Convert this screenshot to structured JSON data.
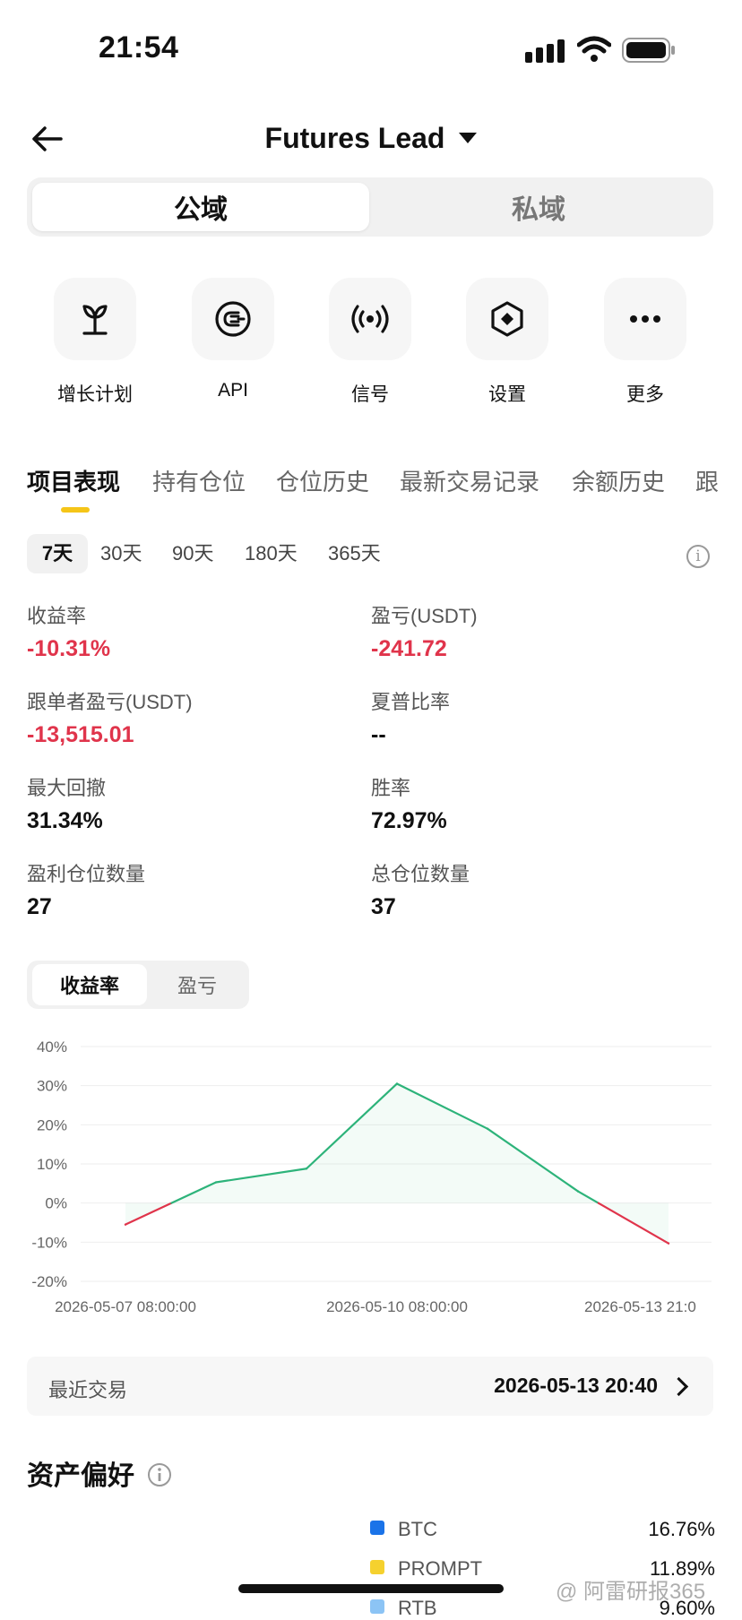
{
  "status_bar": {
    "time": "21:54"
  },
  "header": {
    "title": "Futures Lead"
  },
  "segment": {
    "active": "公域",
    "inactive": "私域"
  },
  "actions": [
    {
      "label": "增长计划",
      "icon": "sprout-icon"
    },
    {
      "label": "API",
      "icon": "plug-icon"
    },
    {
      "label": "信号",
      "icon": "signal-broadcast-icon"
    },
    {
      "label": "设置",
      "icon": "hexagon-settings-icon"
    },
    {
      "label": "更多",
      "icon": "more-dots-icon"
    }
  ],
  "tabs": [
    "项目表现",
    "持有仓位",
    "仓位历史",
    "最新交易记录",
    "余额历史",
    "跟"
  ],
  "periods": [
    "7天",
    "30天",
    "90天",
    "180天",
    "365天"
  ],
  "metrics": [
    {
      "label": "收益率",
      "value": "-10.31%"
    },
    {
      "label": "盈亏(USDT)",
      "value": "-241.72"
    },
    {
      "label": "跟单者盈亏(USDT)",
      "value": "-13,515.01"
    },
    {
      "label": "夏普比率",
      "value": "--"
    },
    {
      "label": "最大回撤",
      "value": "31.34%"
    },
    {
      "label": "胜率",
      "value": "72.97%"
    },
    {
      "label": "盈利仓位数量",
      "value": "27"
    },
    {
      "label": "总仓位数量",
      "value": "37"
    }
  ],
  "chart_toggle": {
    "active": "收益率",
    "inactive": "盈亏"
  },
  "chart_data": {
    "type": "line",
    "title": "",
    "xlabel": "",
    "ylabel": "",
    "ylim": [
      -20,
      40
    ],
    "yticks": [
      "40%",
      "30%",
      "20%",
      "10%",
      "0%",
      "-10%",
      "-20%"
    ],
    "xticks": [
      "2026-05-07 08:00:00",
      "2026-05-10 08:00:00",
      "2026-05-13 21:0"
    ],
    "x": [
      0,
      1,
      2,
      3,
      4,
      5,
      6
    ],
    "values": [
      -5.5,
      5.3,
      8.8,
      30.5,
      19.0,
      3.0,
      -10.3
    ],
    "grid": true,
    "colors": {
      "up": "#2db37a",
      "down": "#e0344b"
    }
  },
  "recent_trade": {
    "label": "最近交易",
    "time": "2026-05-13 20:40"
  },
  "asset_pref": {
    "title": "资产偏好",
    "items": [
      {
        "name": "BTC",
        "value": "16.76%",
        "color": "#1a73e8"
      },
      {
        "name": "PROMPT",
        "value": "11.89%",
        "color": "#f5d12e"
      },
      {
        "name": "RTB",
        "value": "9.60%",
        "color": "#8cc4f5"
      }
    ]
  },
  "watermark": "@ 阿雷研报365"
}
